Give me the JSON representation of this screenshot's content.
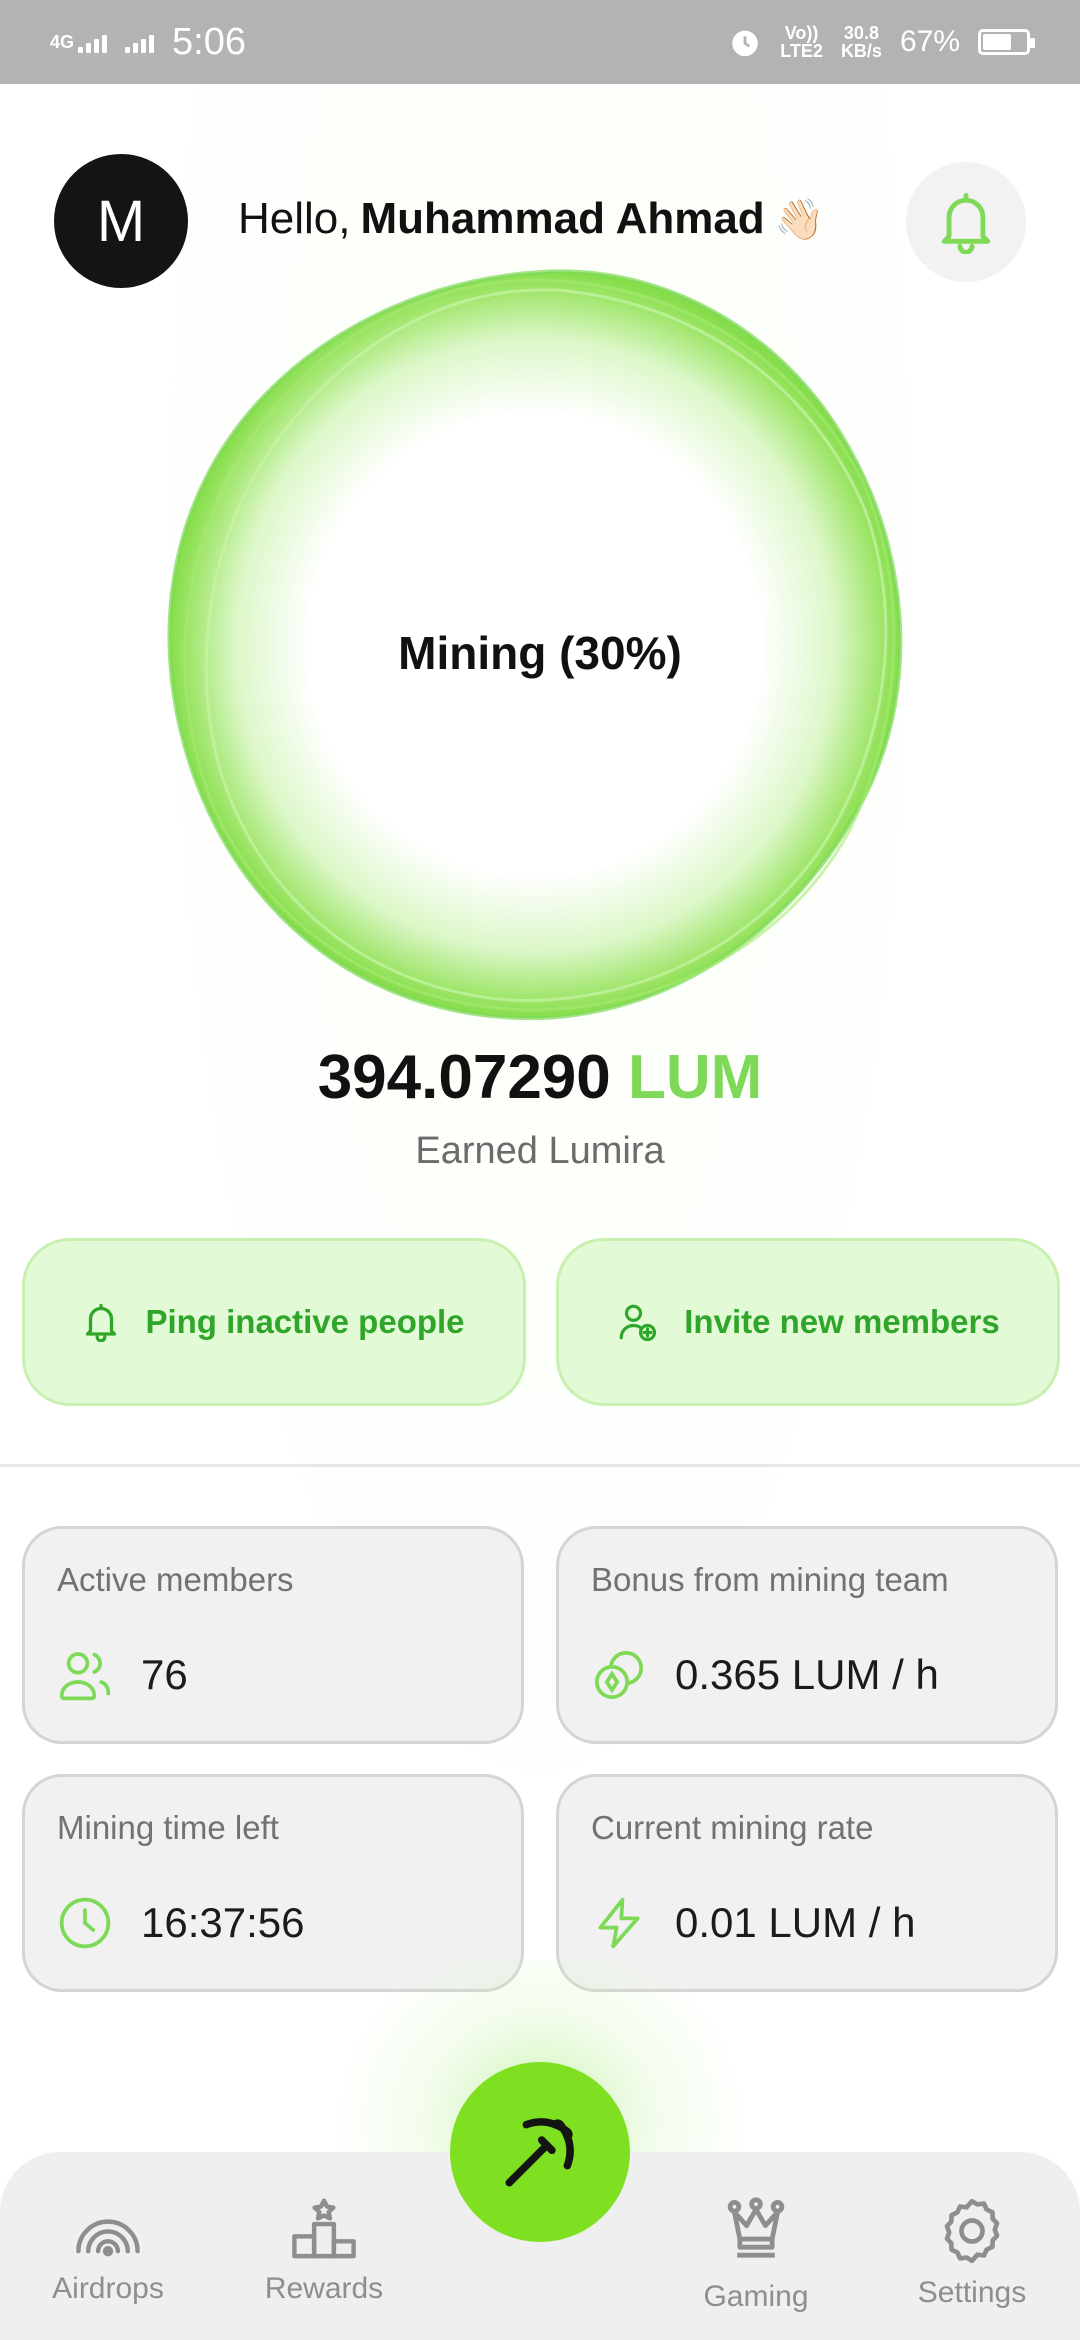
{
  "status_bar": {
    "network": "4G",
    "time": "5:06",
    "volte": "Vo))",
    "lte": "LTE2",
    "speed_value": "30.8",
    "speed_unit": "KB/s",
    "battery": "67%",
    "battery_level": 0.67
  },
  "header": {
    "avatar_letter": "M",
    "greeting_prefix": "Hello,",
    "user_name": "Muhammad Ahmad",
    "wave_emoji": "👋🏻",
    "notification_icon": "bell-icon"
  },
  "mining": {
    "status_label": "Mining (30%)",
    "progress": 0.3,
    "balance_value": "394.07290",
    "balance_unit": "LUM",
    "earned_label": "Earned Lumira"
  },
  "actions": {
    "ping_label": "Ping inactive people",
    "invite_label": "Invite new members"
  },
  "stats": {
    "active_members": {
      "label": "Active members",
      "value": "76",
      "icon": "users-icon"
    },
    "team_bonus": {
      "label": "Bonus from mining team",
      "value": "0.365 LUM / h",
      "icon": "coins-icon"
    },
    "time_left": {
      "label": "Mining time left",
      "value": "16:37:56",
      "icon": "clock-icon"
    },
    "mining_rate": {
      "label": "Current mining rate",
      "value": "0.01 LUM / h",
      "icon": "lightning-icon"
    }
  },
  "nav": {
    "airdrops": "Airdrops",
    "rewards": "Rewards",
    "mine_icon": "pickaxe-icon",
    "gaming": "Gaming",
    "settings": "Settings"
  },
  "colors": {
    "accent": "#7ed957",
    "fab": "#7ee021",
    "action_text": "#2fa52a",
    "action_bg": "#e3fad6"
  }
}
